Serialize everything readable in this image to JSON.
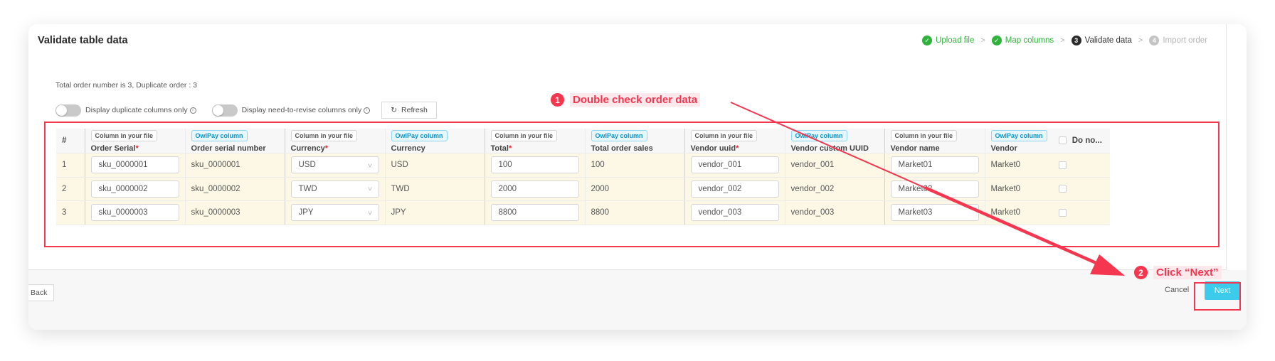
{
  "page": {
    "title": "Validate table data",
    "summary": "Total order number is 3, Duplicate order : 3"
  },
  "steps": [
    {
      "label": "Upload file",
      "state": "done",
      "marker": "✓"
    },
    {
      "label": "Map columns",
      "state": "done",
      "marker": "✓"
    },
    {
      "label": "Validate data",
      "state": "current",
      "marker": "3"
    },
    {
      "label": "Import order",
      "state": "todo",
      "marker": "4"
    }
  ],
  "step_separator": ">",
  "filters": {
    "duplicate_label": "Display duplicate columns only",
    "duplicate_on": false,
    "revise_label": "Display need-to-revise columns only",
    "revise_on": false,
    "refresh_label": "Refresh"
  },
  "table": {
    "index_header": "#",
    "tag_file": "Column in your file",
    "tag_owl": "OwlPay column",
    "columns": {
      "order_serial": "Order Serial",
      "order_serial_owl": "Order serial number",
      "currency": "Currency",
      "currency_owl": "Currency",
      "total": "Total",
      "total_owl": "Total order sales",
      "vendor_uuid": "Vendor uuid",
      "vendor_uuid_owl": "Vendor custom UUID",
      "vendor_name": "Vendor name",
      "vendor_name_owl": "Vendor"
    },
    "required_mark": "*",
    "do_not_header": "Do no...",
    "rows": [
      {
        "index": "1",
        "order_serial": "sku_0000001",
        "order_serial_owl": "sku_0000001",
        "currency": "USD",
        "currency_owl": "USD",
        "total": "100",
        "total_owl": "100",
        "vendor_uuid": "vendor_001",
        "vendor_uuid_owl": "vendor_001",
        "vendor_name": "Market01",
        "vendor_name_owl": "Market0"
      },
      {
        "index": "2",
        "order_serial": "sku_0000002",
        "order_serial_owl": "sku_0000002",
        "currency": "TWD",
        "currency_owl": "TWD",
        "total": "2000",
        "total_owl": "2000",
        "vendor_uuid": "vendor_002",
        "vendor_uuid_owl": "vendor_002",
        "vendor_name": "Market02",
        "vendor_name_owl": "Market0"
      },
      {
        "index": "3",
        "order_serial": "sku_0000003",
        "order_serial_owl": "sku_0000003",
        "currency": "JPY",
        "currency_owl": "JPY",
        "total": "8800",
        "total_owl": "8800",
        "vendor_uuid": "vendor_003",
        "vendor_uuid_owl": "vendor_003",
        "vendor_name": "Market03",
        "vendor_name_owl": "Market0"
      }
    ]
  },
  "footer": {
    "back_label": "Back",
    "cancel_label": "Cancel",
    "next_label": "Next"
  },
  "annotations": [
    {
      "num": "1",
      "text": "Double check order data"
    },
    {
      "num": "2",
      "text": "Click “Next”"
    }
  ],
  "colors": {
    "accent_red": "#f5364f",
    "success_green": "#2fb33b",
    "next_button": "#3ccbea",
    "owlpay_tag": "#0f93c7",
    "row_highlight": "#fdf8e6"
  }
}
